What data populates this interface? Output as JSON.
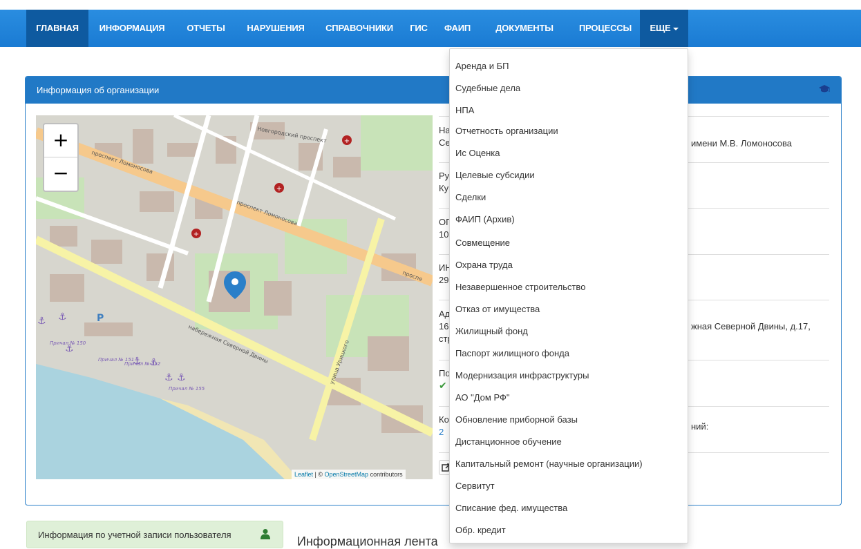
{
  "navbar": {
    "items": [
      {
        "label": "ГЛАВНАЯ"
      },
      {
        "label": "ИНФОРМАЦИЯ"
      },
      {
        "label": "ОТЧЕТЫ"
      },
      {
        "label": "НАРУШЕНИЯ"
      },
      {
        "label": "СПРАВОЧНИКИ"
      },
      {
        "label": "ГИС"
      },
      {
        "label": "ФАИП"
      },
      {
        "label": "ДОКУМЕНТЫ"
      },
      {
        "label": "ПРОЦЕССЫ"
      },
      {
        "label": "ЕЩЕ"
      }
    ]
  },
  "panel": {
    "title": "Информация об организации",
    "icon": "graduation-cap-icon"
  },
  "map": {
    "zoom_in": "+",
    "zoom_out": "−",
    "attribution_leaflet": "Leaflet",
    "attribution_sep": " | © ",
    "attribution_osm": "OpenStreetMap",
    "attribution_tail": " contributors",
    "labels": {
      "prospekt1": "проспект Ломоносова",
      "prospekt2": "проспект Ломоносова",
      "prospekt3": "проспе",
      "novgorod": "Новгородский проспект",
      "nab": "набережная Северной Двины",
      "uritskogo": "улица Урицкого",
      "parking": "P",
      "prichal150": "Причал № 150",
      "prichal151": "Причал № 151",
      "prichal152": "Причал № 152",
      "prichal155": "Причал № 155"
    }
  },
  "info": {
    "row1_line1": "На",
    "row1_line2": "Се",
    "row1_tail": "имени М.В. Ломоносова",
    "row2_line1": "Ру",
    "row2_line2": "Ку",
    "row3_line1": "ОГ",
    "row3_line2": "10",
    "row4_line1": "ИН",
    "row4_line2": "29",
    "row5_line1": "Ад",
    "row5_line2": "16",
    "row5_line3": "стр",
    "row5_tail": "жная Северной Двины, д.17,",
    "row6_line1": "По",
    "row7_line1": "Ко",
    "row7_tail": "ний:",
    "row7_line2": "2"
  },
  "dropdown": {
    "items": [
      "Аренда и БП",
      "Судебные дела",
      "НПА",
      "Отчетность организации",
      "Ис Оценка",
      "Целевые субсидии",
      "Сделки",
      "ФАИП (Архив)",
      "Совмещение",
      "Охрана труда",
      "Незавершенное строительство",
      "Отказ от имущества",
      "Жилищный фонд",
      "Паспорт жилищного фонда",
      "Модернизация инфраструктуры",
      "АО \"Дом РФ\"",
      "Обновление приборной базы",
      "Дистанционное обучение",
      "Капитальный ремонт (научные организации)",
      "Сервитут",
      "Списание фед. имущества",
      "Обр. кредит"
    ]
  },
  "account": {
    "label": "Информация по учетной записи пользователя",
    "icon": "user-icon"
  },
  "feed": {
    "title": "Информационная лента"
  },
  "colors": {
    "navbar": "#1a7bd3",
    "navbar_active": "#0e5aa0",
    "panel_header": "#2179c6",
    "account_bg": "#dff0d8",
    "marker": "#2a7fc9",
    "hospital": "#b22222"
  }
}
